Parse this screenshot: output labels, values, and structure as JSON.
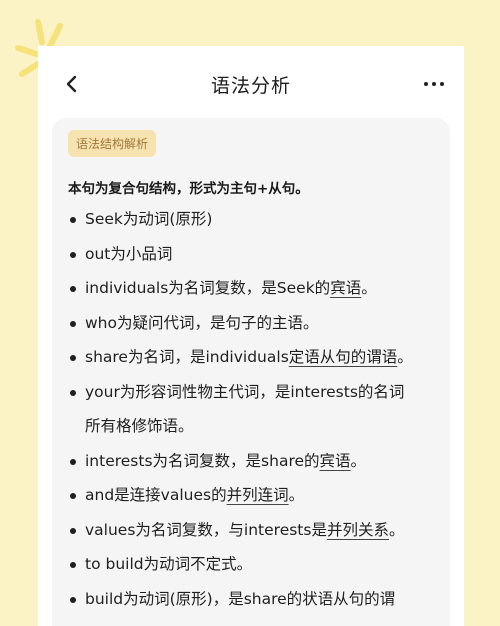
{
  "header": {
    "title": "语法分析"
  },
  "card": {
    "tag": "语法结构解析",
    "summary": "本句为复合句结构，形式为主句+从句。",
    "items": [
      {
        "pre": "Seek为动词(原形)",
        "link": "",
        "post": ""
      },
      {
        "pre": "out为小品词",
        "link": "",
        "post": ""
      },
      {
        "pre": "individuals为名词复数，是Seek的",
        "link": "宾语",
        "post": "。"
      },
      {
        "pre": "who为疑问代词，是句子的主语。",
        "link": "",
        "post": ""
      },
      {
        "pre": "share为名词，是individuals",
        "link": "定语从句的谓语",
        "post": "。"
      },
      {
        "pre": "your为形容词性物主代词，是interests的名词",
        "link": "",
        "post": ""
      },
      {
        "pre": "所有格修饰语。",
        "link": "",
        "post": ""
      },
      {
        "pre": "interests为名词复数，是share的",
        "link": "宾语",
        "post": "。"
      },
      {
        "pre": "and是连接values的",
        "link": "并列连词",
        "post": "。"
      },
      {
        "pre": "values为名词复数，与interests是",
        "link": "并列关系",
        "post": "。"
      },
      {
        "pre": "to build为动词不定式。",
        "link": "",
        "post": ""
      },
      {
        "pre": "build为动词(原形)，是share的状语从句的谓",
        "link": "",
        "post": ""
      }
    ]
  },
  "colors": {
    "background": "#fbf3c6",
    "tag_bg": "#f7e3b0",
    "tag_text": "#a3773a",
    "card_bg": "#f5f5f5"
  }
}
